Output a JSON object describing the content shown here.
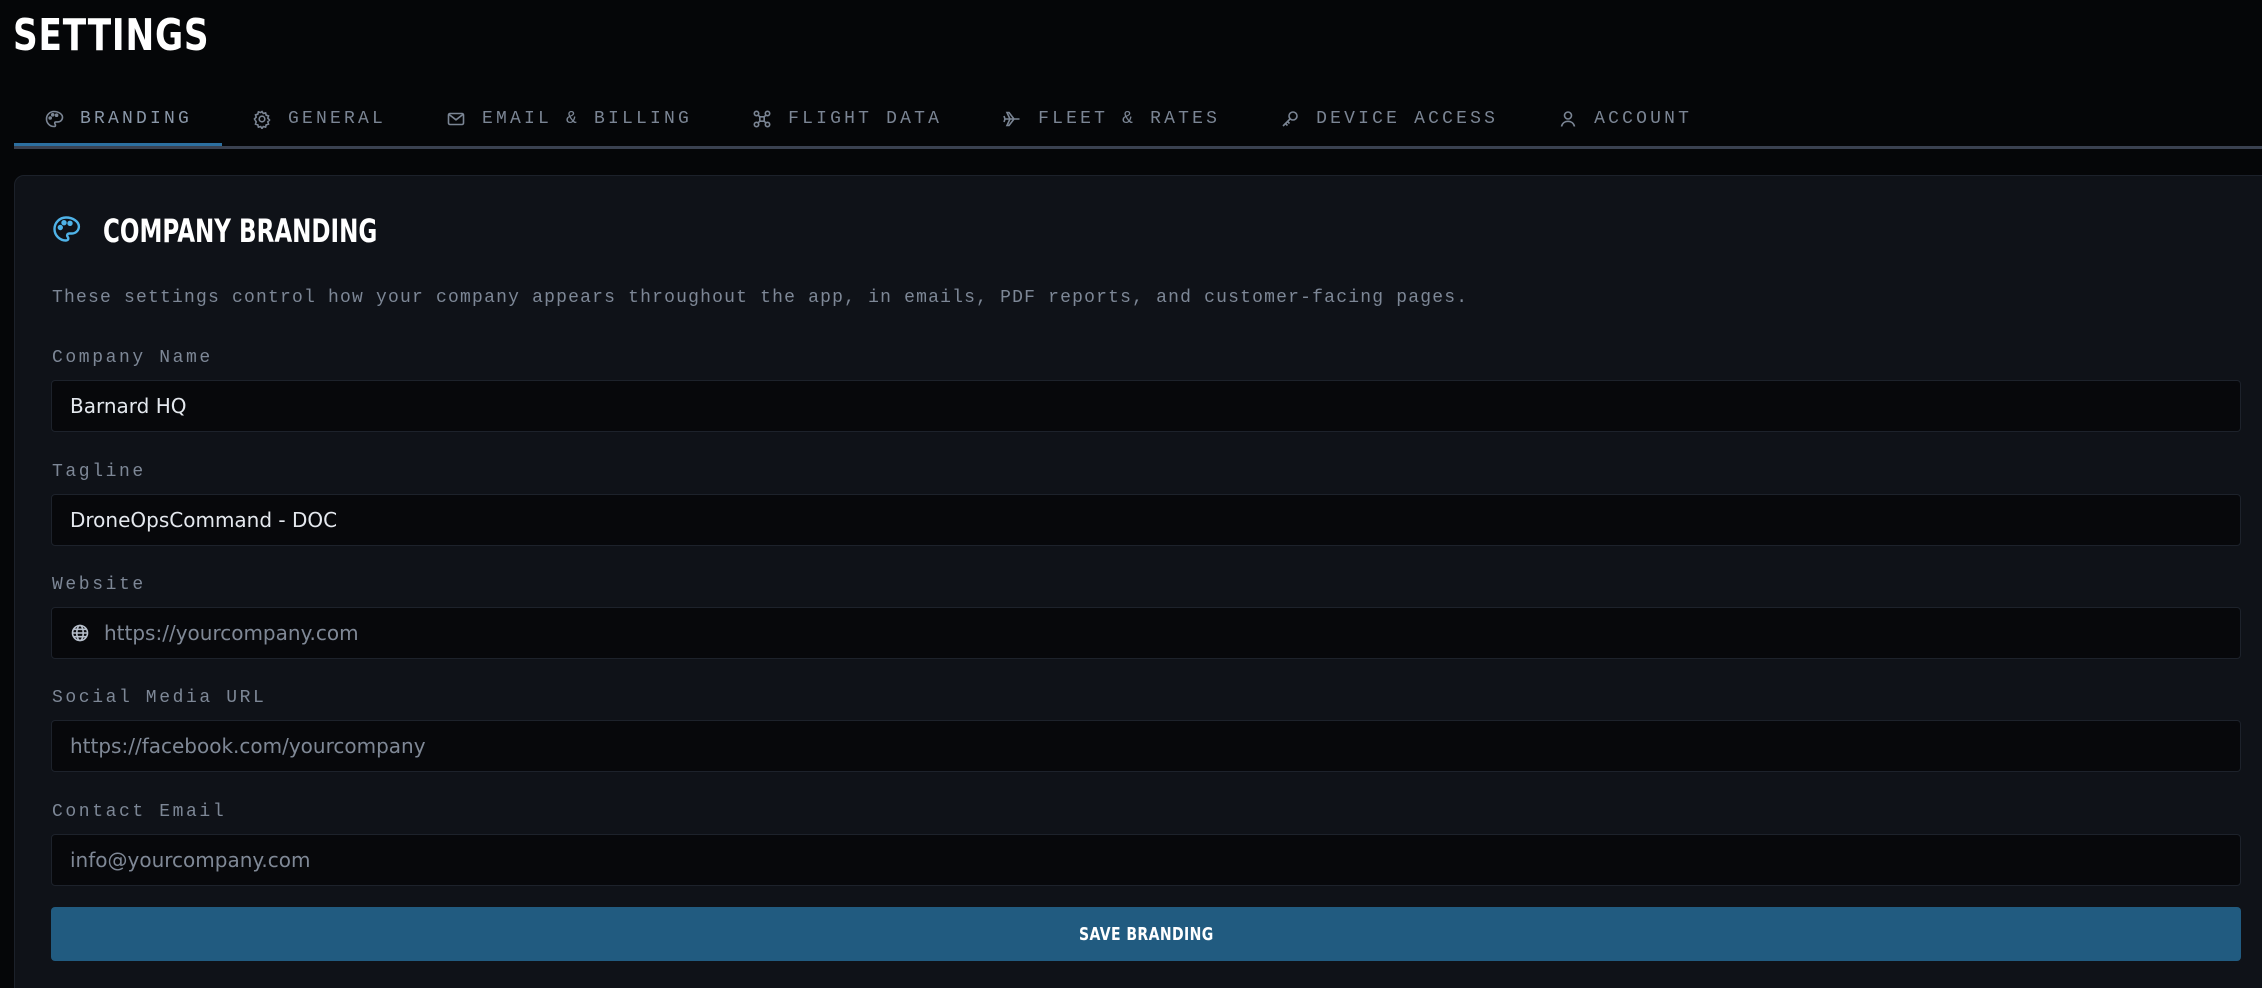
{
  "header": {
    "title": "SETTINGS"
  },
  "tabs": [
    {
      "label": "BRANDING",
      "icon": "palette-icon",
      "active": true
    },
    {
      "label": "GENERAL",
      "icon": "gear-icon",
      "active": false
    },
    {
      "label": "EMAIL & BILLING",
      "icon": "mail-icon",
      "active": false
    },
    {
      "label": "FLIGHT DATA",
      "icon": "drone-icon",
      "active": false
    },
    {
      "label": "FLEET & RATES",
      "icon": "plane-icon",
      "active": false
    },
    {
      "label": "DEVICE ACCESS",
      "icon": "key-icon",
      "active": false
    },
    {
      "label": "ACCOUNT",
      "icon": "user-icon",
      "active": false
    }
  ],
  "card": {
    "title": "COMPANY BRANDING",
    "icon": "palette-icon",
    "description": "These settings control how your company appears throughout the app, in emails, PDF reports, and customer-facing pages.",
    "fields": {
      "company_name": {
        "label": "Company Name",
        "value": "Barnard HQ",
        "placeholder": ""
      },
      "tagline": {
        "label": "Tagline",
        "value": "DroneOpsCommand - DOC",
        "placeholder": ""
      },
      "website": {
        "label": "Website",
        "value": "",
        "placeholder": "https://yourcompany.com",
        "icon": "globe-icon"
      },
      "social_media_url": {
        "label": "Social Media URL",
        "value": "",
        "placeholder": "https://facebook.com/yourcompany"
      },
      "contact_email": {
        "label": "Contact Email",
        "value": "",
        "placeholder": "info@yourcompany.com"
      }
    },
    "save_label": "SAVE BRANDING"
  },
  "colors": {
    "background": "#050608",
    "card": "#0f1218",
    "accent": "#2c6fa0",
    "button": "#215b80",
    "icon_accent": "#4fb3e8"
  }
}
